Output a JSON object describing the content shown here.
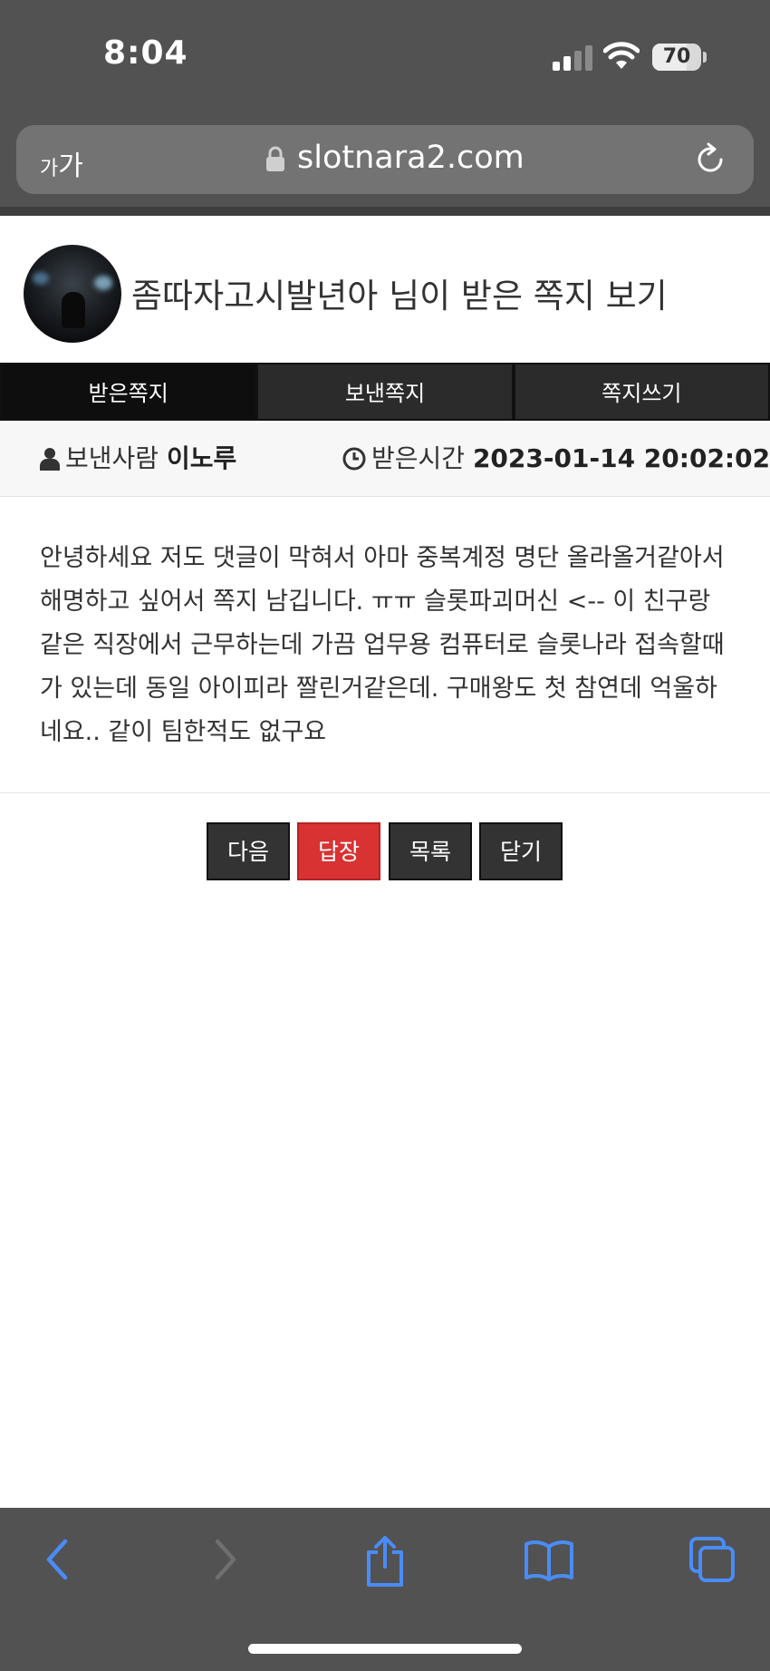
{
  "status_bar": {
    "time": "8:04",
    "battery": "70",
    "battery_level": 0.7
  },
  "browser": {
    "text_size_label_small": "가",
    "text_size_label": "가",
    "url": "slotnara2.com"
  },
  "page": {
    "title": "좀따자고시발년아 님이 받은 쪽지 보기"
  },
  "tabs": [
    {
      "label": "받은쪽지",
      "active": true
    },
    {
      "label": "보낸쪽지",
      "active": false
    },
    {
      "label": "쪽지쓰기",
      "active": false
    }
  ],
  "meta": {
    "sender_label": "보낸사람",
    "sender_value": "이노루",
    "received_label": "받은시간",
    "received_value": "2023-01-14 20:02:02"
  },
  "message": {
    "body": "안녕하세요 저도 댓글이 막혀서 아마 중복계정 명단 올라올거같아서 해명하고 싶어서 쪽지 남깁니다. ㅠㅠ 슬롯파괴머신 <-- 이 친구랑 같은 직장에서 근무하는데 가끔 업무용 컴퓨터로 슬롯나라 접속할때가 있는데 동일 아이피라 짤린거같은데. 구매왕도 첫 참연데 억울하네요.. 같이 팀한적도 없구요"
  },
  "actions": {
    "next": "다음",
    "reply": "답장",
    "list": "목록",
    "close": "닫기"
  },
  "colors": {
    "chrome": "#525252",
    "accent_ios": "#4a8cf7",
    "reply_button": "#d83232",
    "tab_bg": "#2b2b2b"
  },
  "icons": {
    "sender": "user-icon",
    "time": "clock-icon",
    "lock": "lock-icon",
    "reload": "reload-icon",
    "back": "chevron-left-icon",
    "forward": "chevron-right-icon",
    "share": "share-icon",
    "bookmarks": "book-icon",
    "tabs": "tabs-icon"
  }
}
